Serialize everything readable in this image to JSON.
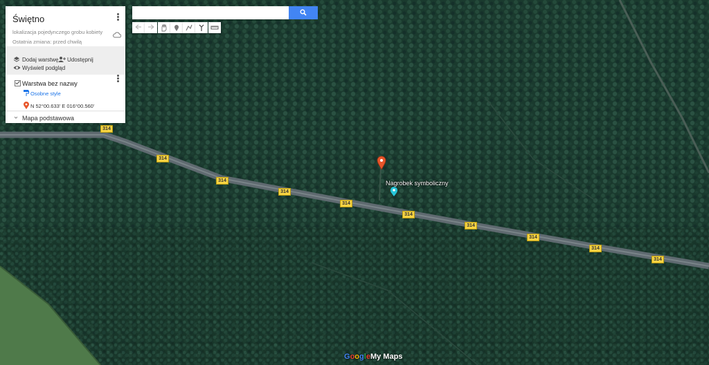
{
  "panel": {
    "title": "Świętno",
    "description": "lokalizacja pojedynczego grobu kobiety",
    "last_change": "Ostatnia zmiana: przed chwilą",
    "add_layer": "Dodaj warstwę",
    "share": "Udostępnij",
    "preview": "Wyświetl podgląd",
    "layer_name": "Warstwa bez nazwy",
    "style_link": "Osobne style",
    "coordinates": "N 52°00.633' E 016°00.560'",
    "base_map": "Mapa podstawowa"
  },
  "search": {
    "placeholder": ""
  },
  "toolbar": [
    "undo-icon",
    "redo-icon",
    "hand-icon",
    "marker-icon",
    "line-icon",
    "route-icon",
    "ruler-icon"
  ],
  "map": {
    "road_number": "314",
    "poi_label": "Nagrobek symboliczny",
    "logo_google": [
      "G",
      "o",
      "o",
      "g",
      "l",
      "e"
    ],
    "logo_mymaps": "My Maps"
  },
  "colors": {
    "accent": "#4285f4",
    "marker": "#e8562b",
    "poi": "#26c6da",
    "road_shield": "#f7d443"
  }
}
